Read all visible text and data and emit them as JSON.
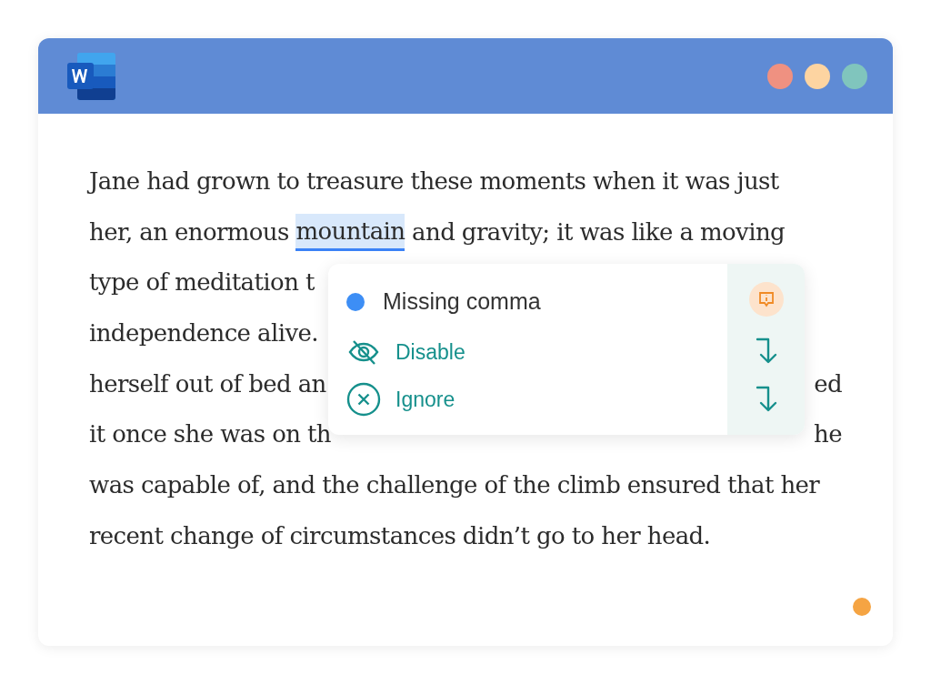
{
  "window": {
    "controls": [
      {
        "color": "#ef9181"
      },
      {
        "color": "#fdd4a1"
      },
      {
        "color": "#80c5bd"
      }
    ]
  },
  "document": {
    "lines": [
      {
        "segments": [
          {
            "text": "Jane had grown to treasure these moments when it was just",
            "kind": "plain"
          }
        ]
      },
      {
        "segments": [
          {
            "text": "her, an enormous ",
            "kind": "plain"
          },
          {
            "text": "mountain",
            "kind": "flagged"
          },
          {
            "text": " and gravity; it was like a moving",
            "kind": "plain"
          }
        ]
      },
      {
        "segments": [
          {
            "text": "type of meditation t",
            "kind": "plain"
          }
        ]
      },
      {
        "segments": [
          {
            "text": "independence alive.",
            "kind": "plain"
          }
        ]
      },
      {
        "segments": [
          {
            "text": "herself out of bed an",
            "kind": "plain"
          },
          {
            "text": "ed",
            "kind": "right"
          }
        ]
      },
      {
        "segments": [
          {
            "text": "it once she was on th",
            "kind": "plain"
          },
          {
            "text": "he",
            "kind": "right"
          }
        ]
      },
      {
        "segments": [
          {
            "text": "was capable of, and the challenge of the climb ensured that her",
            "kind": "plain"
          }
        ]
      },
      {
        "segments": [
          {
            "text": "recent change of circumstances didn’t go to her head.",
            "kind": "plain"
          }
        ]
      }
    ]
  },
  "suggestion": {
    "title": "Missing comma",
    "color": "#3d8ef5",
    "actions": [
      {
        "label": "Disable",
        "kind": "disable"
      },
      {
        "label": "Ignore",
        "kind": "ignore"
      }
    ]
  },
  "status_dot": {
    "color": "#f5a443"
  }
}
